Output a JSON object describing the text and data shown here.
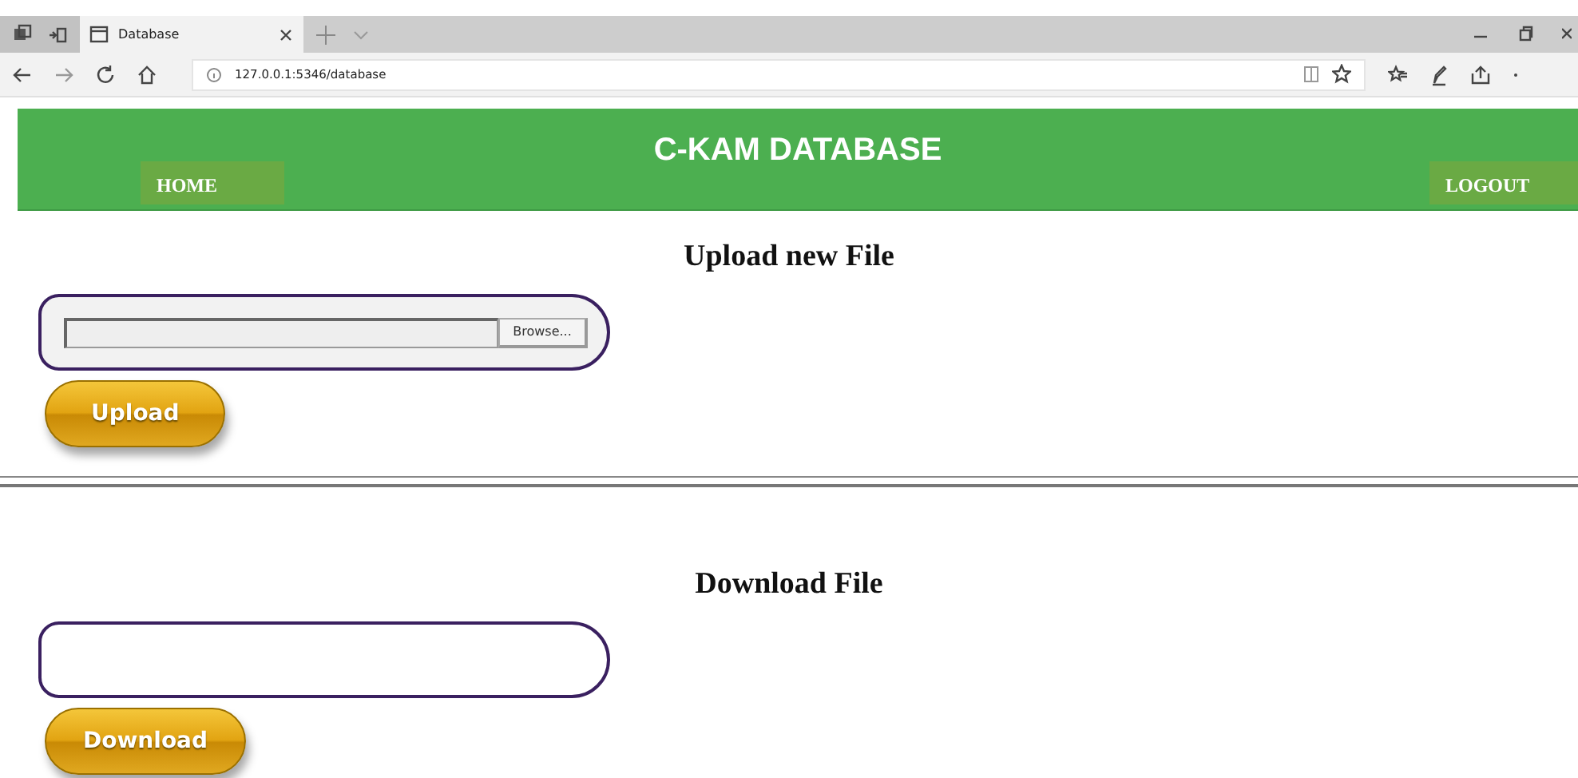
{
  "browser": {
    "tab_title": "Database",
    "url": "127.0.0.1:5346/database"
  },
  "header": {
    "title": "C-KAM DATABASE",
    "nav": [
      {
        "label": "HOME"
      },
      {
        "label": "LOGOUT"
      }
    ]
  },
  "upload": {
    "heading": "Upload new File",
    "browse_label": "Browse...",
    "button": "Upload"
  },
  "download": {
    "heading": "Download File",
    "button": "Download"
  }
}
